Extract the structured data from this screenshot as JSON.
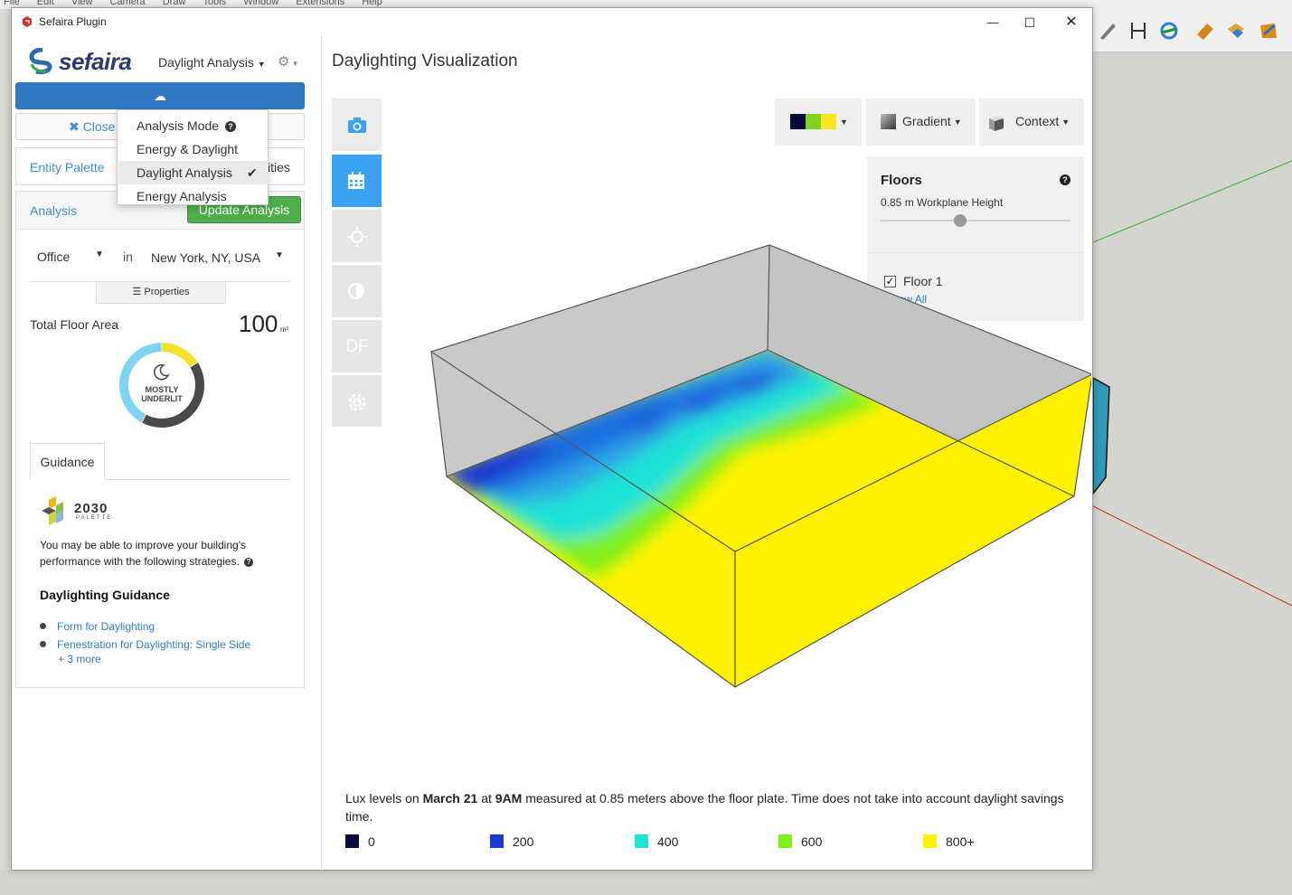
{
  "background": {
    "menubar": [
      "File",
      "Edit",
      "View",
      "Camera",
      "Draw",
      "Tools",
      "Window",
      "Extensions",
      "Help"
    ]
  },
  "window": {
    "title": "Sefaira Plugin",
    "minimize_glyph": "—",
    "maximize_glyph": "☐",
    "close_glyph": "✕"
  },
  "left": {
    "logo_text": "sefaira",
    "mode_select": "Daylight Analysis",
    "upload_glyph": "☁",
    "close_label": "✖ Close",
    "tabs": {
      "entity": "Entity Palette",
      "quantities_partial": "ities"
    },
    "analysis": {
      "title": "Analysis",
      "update_button": "Update Analysis",
      "building_type": "Office",
      "in_label": "in",
      "location": "New York, NY, USA",
      "properties_button": "☰ Properties",
      "floor_area_label": "Total Floor Area",
      "floor_area_value": "100",
      "floor_area_unit": "m²",
      "status_line1": "MOSTLY",
      "status_line2": "UNDERLIT",
      "donut_fractions": {
        "yellow": 0.16,
        "dark": 0.42,
        "blue": 0.42
      }
    },
    "guidance": {
      "tab": "Guidance",
      "palette_title": "2030",
      "palette_subtitle": "PALETTE",
      "intro": "You may be able to improve your building's performance with the following strategies.",
      "heading": "Daylighting Guidance",
      "items": [
        "Form for Daylighting",
        "Fenestration for Daylighting: Single Side"
      ],
      "more": "+ 3 more"
    }
  },
  "dropdown": {
    "items": [
      {
        "label": "Analysis Mode",
        "help": "?"
      },
      {
        "label": "Energy & Daylight"
      },
      {
        "label": "Daylight Analysis",
        "checked": true
      },
      {
        "label": "Energy Analysis"
      }
    ],
    "check": "✔"
  },
  "viz": {
    "title": "Daylighting Visualization",
    "df_label": "DF",
    "controls": {
      "gradient": "Gradient",
      "context": "Context",
      "swatches": [
        "#0a0a3a",
        "#7ed321",
        "#f8e71c"
      ]
    },
    "floors": {
      "title": "Floors",
      "help": "?",
      "workplane": "0.85 m Workplane Height",
      "slider_fraction": 0.42,
      "floor_label": "Floor 1",
      "floor_checked": "✓",
      "show_all": "Show All"
    },
    "caption": {
      "pre": "Lux levels on ",
      "date": "March 21",
      "mid": " at ",
      "time": "9AM",
      "post": " measured at 0.85 meters above the floor plate. Time does not take into account daylight savings time."
    },
    "legend": [
      {
        "label": "0",
        "color": "#0b0b3b"
      },
      {
        "label": "200",
        "color": "#1a3bd1"
      },
      {
        "label": "400",
        "color": "#1ee3d6"
      },
      {
        "label": "600",
        "color": "#7ef01a"
      },
      {
        "label": "800+",
        "color": "#fff200"
      }
    ]
  }
}
